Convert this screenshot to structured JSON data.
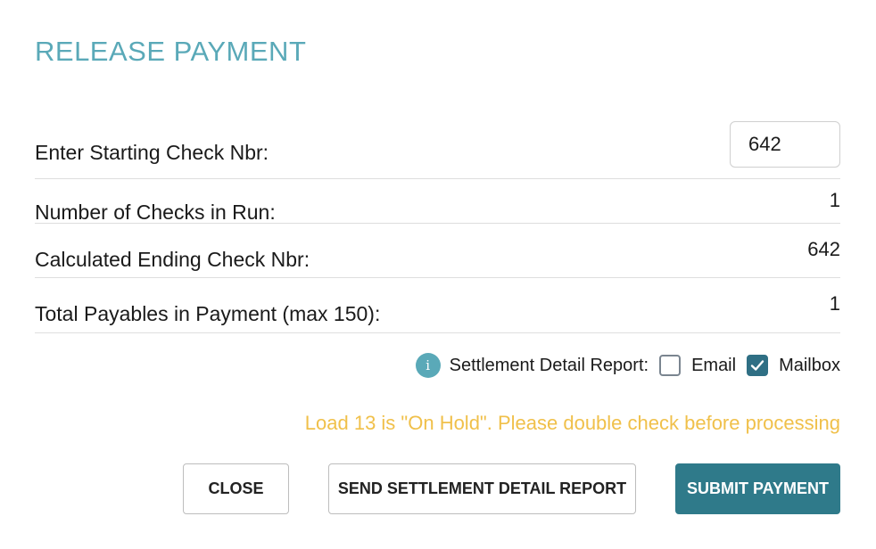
{
  "dialog": {
    "title": "RELEASE PAYMENT"
  },
  "fields": {
    "starting_check": {
      "label": "Enter Starting Check Nbr:",
      "value": "642"
    },
    "num_checks": {
      "label": "Number of Checks in Run:",
      "value": "1"
    },
    "ending_check": {
      "label": "Calculated Ending Check Nbr:",
      "value": "642"
    },
    "total_payables": {
      "label": "Total Payables in Payment (max 150):",
      "value": "1"
    }
  },
  "report": {
    "info_glyph": "i",
    "label": "Settlement Detail Report:",
    "email": {
      "label": "Email",
      "checked": false
    },
    "mailbox": {
      "label": "Mailbox",
      "checked": true
    }
  },
  "warning": "Load 13 is \"On Hold\". Please double check before processing",
  "buttons": {
    "close": "CLOSE",
    "send_report": "SEND SETTLEMENT DETAIL REPORT",
    "submit": "SUBMIT PAYMENT"
  },
  "colors": {
    "title": "#5aa9b8",
    "warning": "#f0c04a",
    "primary_button": "#2f7a8a",
    "checkbox_checked": "#2f6f84"
  }
}
